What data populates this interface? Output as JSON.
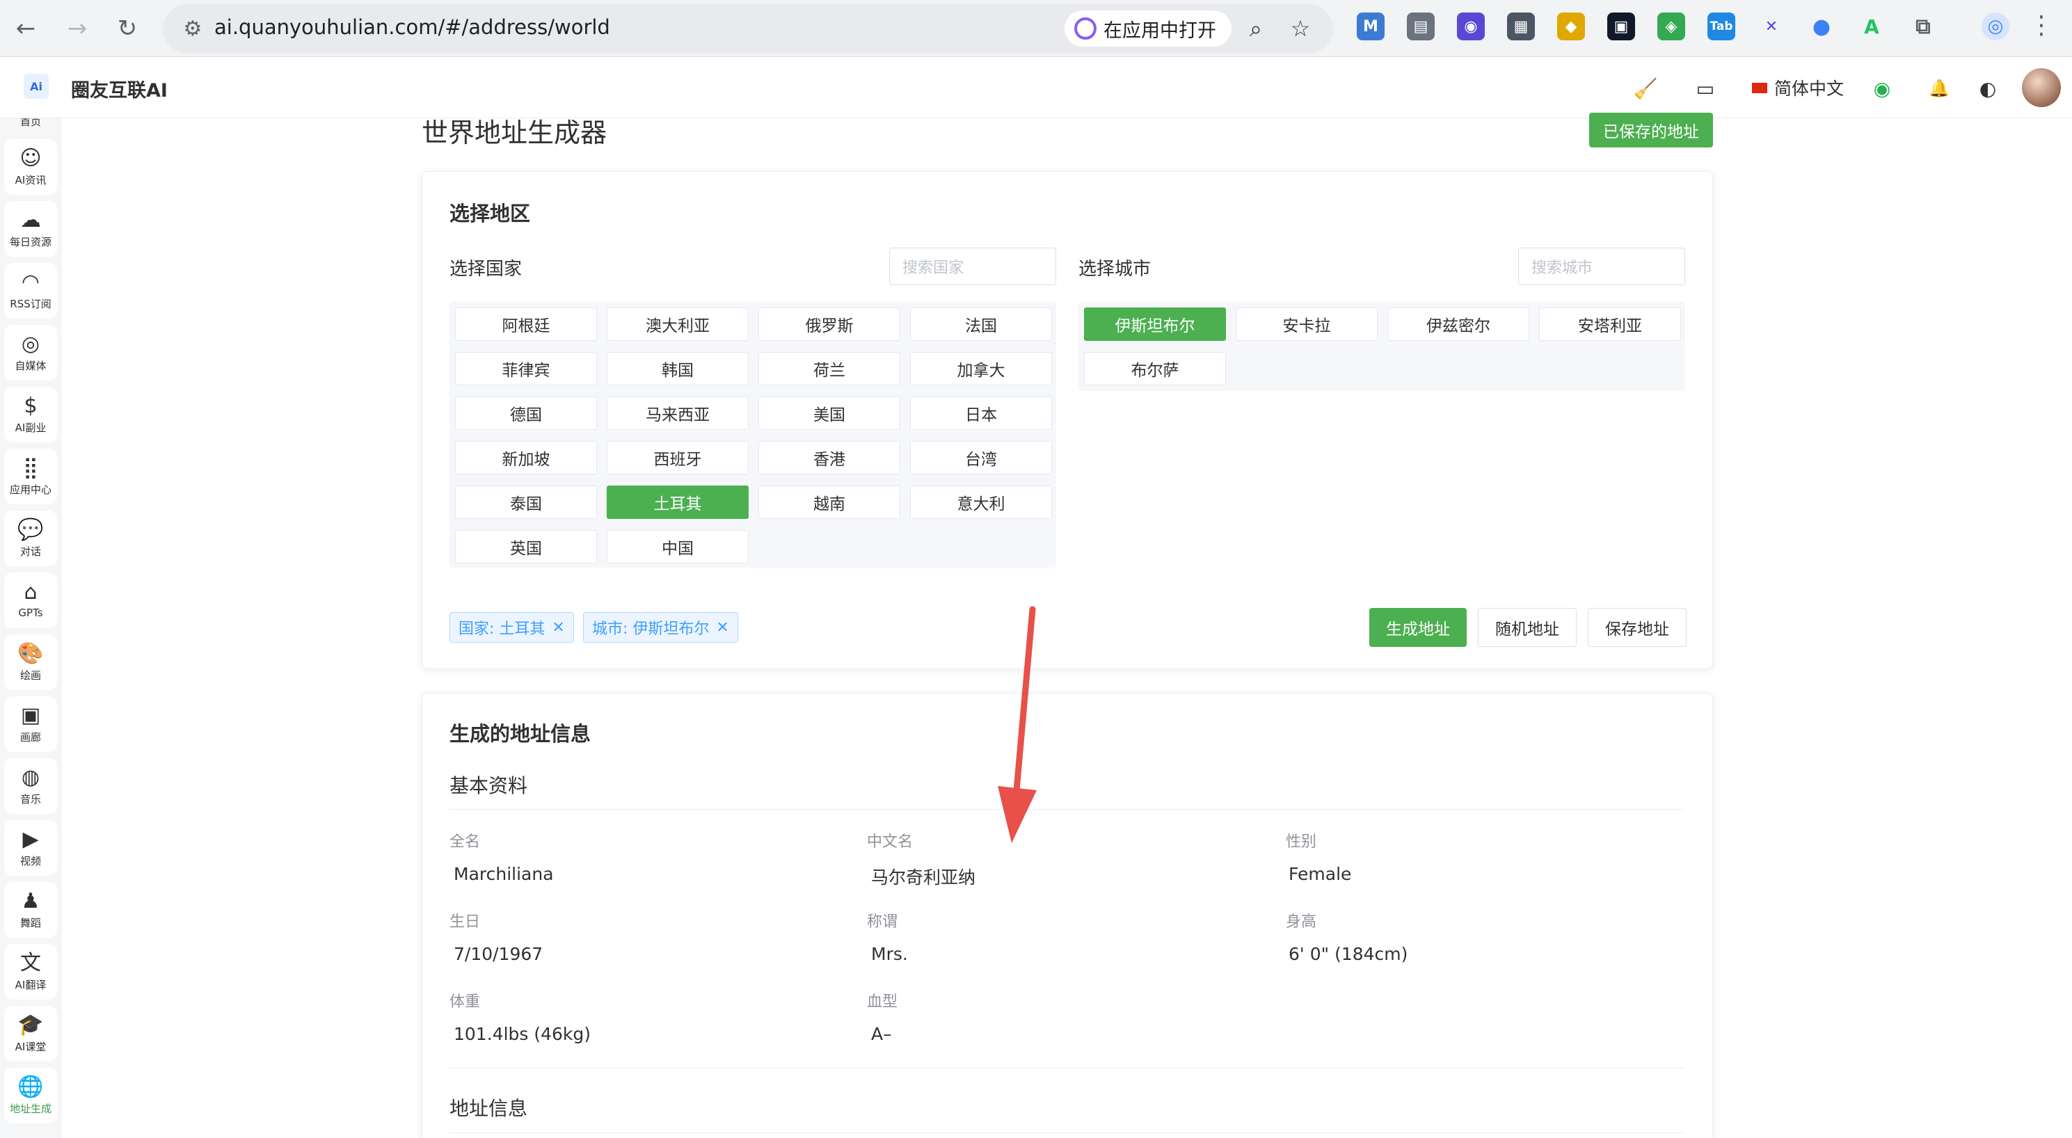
{
  "browser": {
    "back_icon": "arrow-left-icon",
    "url": "ai.quanyouhulian.com/#/address/world",
    "open_in_app": "在应用中打开",
    "extensions": [
      "M",
      "▤",
      "◉",
      "▦",
      "◆",
      "▣",
      "◈",
      "Tab",
      "✕",
      "●",
      "A",
      "⧉",
      "◎"
    ]
  },
  "header": {
    "app_name": "圈友互联AI",
    "logo_text": "Ai",
    "language": "简体中文"
  },
  "sidebar": {
    "cut_label": "首页",
    "items": [
      {
        "label": "AI资讯",
        "icon": "robot-icon"
      },
      {
        "label": "每日资源",
        "icon": "cloud-download-icon"
      },
      {
        "label": "RSS订阅",
        "icon": "rss-icon"
      },
      {
        "label": "自媒体",
        "icon": "broadcast-icon"
      },
      {
        "label": "AI副业",
        "icon": "dollar-icon"
      },
      {
        "label": "应用中心",
        "icon": "grid-icon"
      },
      {
        "label": "对话",
        "icon": "chat-icon"
      },
      {
        "label": "GPTs",
        "icon": "store-icon"
      },
      {
        "label": "绘画",
        "icon": "palette-icon"
      },
      {
        "label": "画廊",
        "icon": "image-icon"
      },
      {
        "label": "音乐",
        "icon": "music-icon"
      },
      {
        "label": "视频",
        "icon": "video-icon"
      },
      {
        "label": "舞蹈",
        "icon": "dance-icon"
      },
      {
        "label": "AI翻译",
        "icon": "translate-icon"
      },
      {
        "label": "AI课堂",
        "icon": "graduation-cap-icon"
      },
      {
        "label": "地址生成",
        "icon": "globe-icon"
      }
    ]
  },
  "page": {
    "title": "世界地址生成器",
    "saved_button": "已保存的地址"
  },
  "region": {
    "title": "选择地区",
    "country_label": "选择国家",
    "country_search_placeholder": "搜索国家",
    "city_label": "选择城市",
    "city_search_placeholder": "搜索城市",
    "countries": [
      "阿根廷",
      "澳大利亚",
      "俄罗斯",
      "法国",
      "菲律宾",
      "韩国",
      "荷兰",
      "加拿大",
      "德国",
      "马来西亚",
      "美国",
      "日本",
      "新加坡",
      "西班牙",
      "香港",
      "台湾",
      "泰国",
      "土耳其",
      "越南",
      "意大利",
      "英国",
      "中国"
    ],
    "selected_country": "土耳其",
    "cities": [
      "伊斯坦布尔",
      "安卡拉",
      "伊兹密尔",
      "安塔利亚",
      "布尔萨"
    ],
    "selected_city": "伊斯坦布尔",
    "country_tag": "国家: 土耳其",
    "city_tag": "城市: 伊斯坦布尔",
    "generate_button": "生成地址",
    "random_button": "随机地址",
    "save_button": "保存地址"
  },
  "result": {
    "title": "生成的地址信息",
    "basic_section": "基本资料",
    "address_section": "地址信息",
    "fields": {
      "full_name": {
        "label": "全名",
        "value": "Marchiliana"
      },
      "chinese_name": {
        "label": "中文名",
        "value": "马尔奇利亚纳"
      },
      "gender": {
        "label": "性别",
        "value": "Female"
      },
      "birthday": {
        "label": "生日",
        "value": "7/10/1967"
      },
      "title": {
        "label": "称谓",
        "value": "Mrs."
      },
      "height": {
        "label": "身高",
        "value": "6' 0\" (184cm)"
      },
      "weight": {
        "label": "体重",
        "value": "101.4lbs (46kg)"
      },
      "blood_type": {
        "label": "血型",
        "value": "A–"
      }
    }
  },
  "colors": {
    "primary_green": "#4caf50",
    "tag_blue": "#409eff",
    "annotation_red": "#e8504a"
  }
}
